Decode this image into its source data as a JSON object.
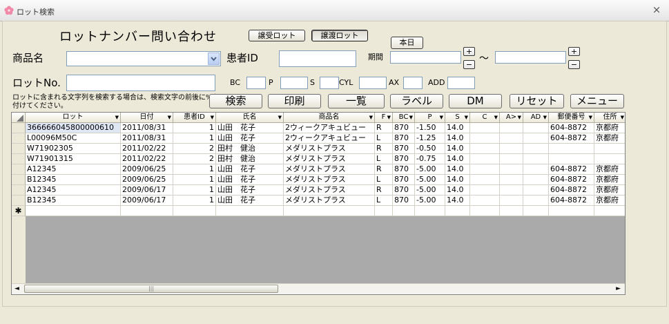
{
  "window": {
    "title": "ロット検索",
    "close_glyph": "×",
    "icon": "sakura-flower-icon"
  },
  "heading": "ロットナンバー問い合わせ",
  "buttons": {
    "transfer_in": "譲受ロット",
    "transfer_out": "譲渡ロット",
    "today": "本日"
  },
  "form": {
    "product_label": "商品名",
    "product_value": "",
    "patient_id_label": "患者ID",
    "patient_id_value": "",
    "period_label": "期間",
    "period_start": "",
    "period_end": "",
    "period_sep": "～",
    "spin_up": "+",
    "spin_down": "−",
    "lot_label": "ロットNo.",
    "lot_value": "",
    "bc_label": "BC",
    "p_label": "P",
    "s_label": "S",
    "cyl_label": "CYL",
    "ax_label": "AX",
    "add_label": "ADD"
  },
  "note": "ロットに含まれる文字列を検索する場合は、検索文字の前後に%を付けてください。",
  "actions": {
    "search": "検索",
    "print": "印刷",
    "list": "一覧",
    "label": "ラベル",
    "dm": "DM",
    "reset": "リセット",
    "menu": "メニュー"
  },
  "grid": {
    "columns": [
      "ロット",
      "日付",
      "患者ID",
      "氏名",
      "商品名",
      "F",
      "BC",
      "P",
      "S",
      "C",
      "A>",
      "AD",
      "郵便番号",
      "住所"
    ],
    "rows": [
      [
        "366666045800000610",
        "2011/08/31",
        "1",
        "山田　花子",
        "2ウィークアキュビュー",
        "R",
        "870",
        "-1.50",
        "14.0",
        "",
        "",
        "",
        "604-8872",
        "京都府"
      ],
      [
        "L00096M50C",
        "2011/08/31",
        "1",
        "山田　花子",
        "2ウィークアキュビュー",
        "L",
        "870",
        "-1.25",
        "14.0",
        "",
        "",
        "",
        "604-8872",
        "京都府"
      ],
      [
        "W71902305",
        "2011/02/22",
        "2",
        "田村　健治",
        "メダリストプラス",
        "R",
        "870",
        "-0.50",
        "14.0",
        "",
        "",
        "",
        "",
        ""
      ],
      [
        "W71901315",
        "2011/02/22",
        "2",
        "田村　健治",
        "メダリストプラス",
        "L",
        "870",
        "-0.75",
        "14.0",
        "",
        "",
        "",
        "",
        ""
      ],
      [
        "A12345",
        "2009/06/25",
        "1",
        "山田　花子",
        "メダリストプラス",
        "R",
        "870",
        "-5.00",
        "14.0",
        "",
        "",
        "",
        "604-8872",
        "京都府"
      ],
      [
        "B12345",
        "2009/06/25",
        "1",
        "山田　花子",
        "メダリストプラス",
        "L",
        "870",
        "-5.00",
        "14.0",
        "",
        "",
        "",
        "604-8872",
        "京都府"
      ],
      [
        "A12345",
        "2009/06/17",
        "1",
        "山田　花子",
        "メダリストプラス",
        "R",
        "870",
        "-5.00",
        "14.0",
        "",
        "",
        "",
        "604-8872",
        "京都府"
      ],
      [
        "B12345",
        "2009/06/17",
        "1",
        "山田　花子",
        "メダリストプラス",
        "L",
        "870",
        "-5.00",
        "14.0",
        "",
        "",
        "",
        "604-8872",
        "京都府"
      ]
    ],
    "new_row_marker": "✱",
    "scroll_left": "◄",
    "scroll_right": "►",
    "thumb_grip": "|||"
  }
}
